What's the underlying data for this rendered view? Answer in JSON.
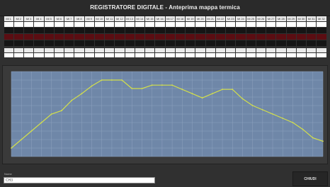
{
  "window": {
    "title": "REGISTRATORE DIGITALE - Anteprima mappa termica"
  },
  "channels": [
    "Mi 1",
    "Mi 2",
    "Mi 3",
    "Mi 4",
    "Mi 5",
    "Mi 6",
    "Mi 7",
    "Mi 8",
    "Mi 9",
    "Mi 10",
    "Mi 11",
    "Mi 12",
    "Mi 13",
    "Mi 14",
    "Mi 15",
    "Mi 16",
    "Mi 17",
    "Mi 18",
    "Mi 19",
    "Mi 20",
    "Mi 21",
    "Mi 22",
    "Mi 23",
    "Mi 24",
    "Mi 25",
    "Mi 26",
    "Mi 27",
    "Mi 28",
    "Mi 29",
    "Mi 30",
    "Mi 31",
    "Mi 32"
  ],
  "name_field": {
    "label": "Nome",
    "value": "CH3"
  },
  "close_button": {
    "label": "CHIUDI"
  },
  "colors": {
    "plot_background": "#6f87a8",
    "grid": "#8ea2bf",
    "line": "#d4e04a",
    "channel_alarm": "#5b0d12"
  },
  "chart_data": {
    "type": "line",
    "x": [
      0,
      1,
      2,
      3,
      4,
      5,
      6,
      7,
      8,
      9,
      10,
      11,
      12,
      13,
      14,
      15,
      16,
      17,
      18,
      19,
      20,
      21,
      22,
      23,
      24,
      25,
      26,
      27,
      28,
      29,
      30,
      31
    ],
    "series": [
      {
        "values": [
          10,
          20,
          30,
          40,
          50,
          54,
          66,
          74,
          83,
          90,
          90,
          90,
          80,
          80,
          84,
          84,
          84,
          79,
          74,
          69,
          74,
          79,
          79,
          68,
          60,
          55,
          50,
          45,
          40,
          32,
          22,
          18
        ]
      }
    ],
    "ylim": [
      0,
      100
    ],
    "grid": true
  }
}
